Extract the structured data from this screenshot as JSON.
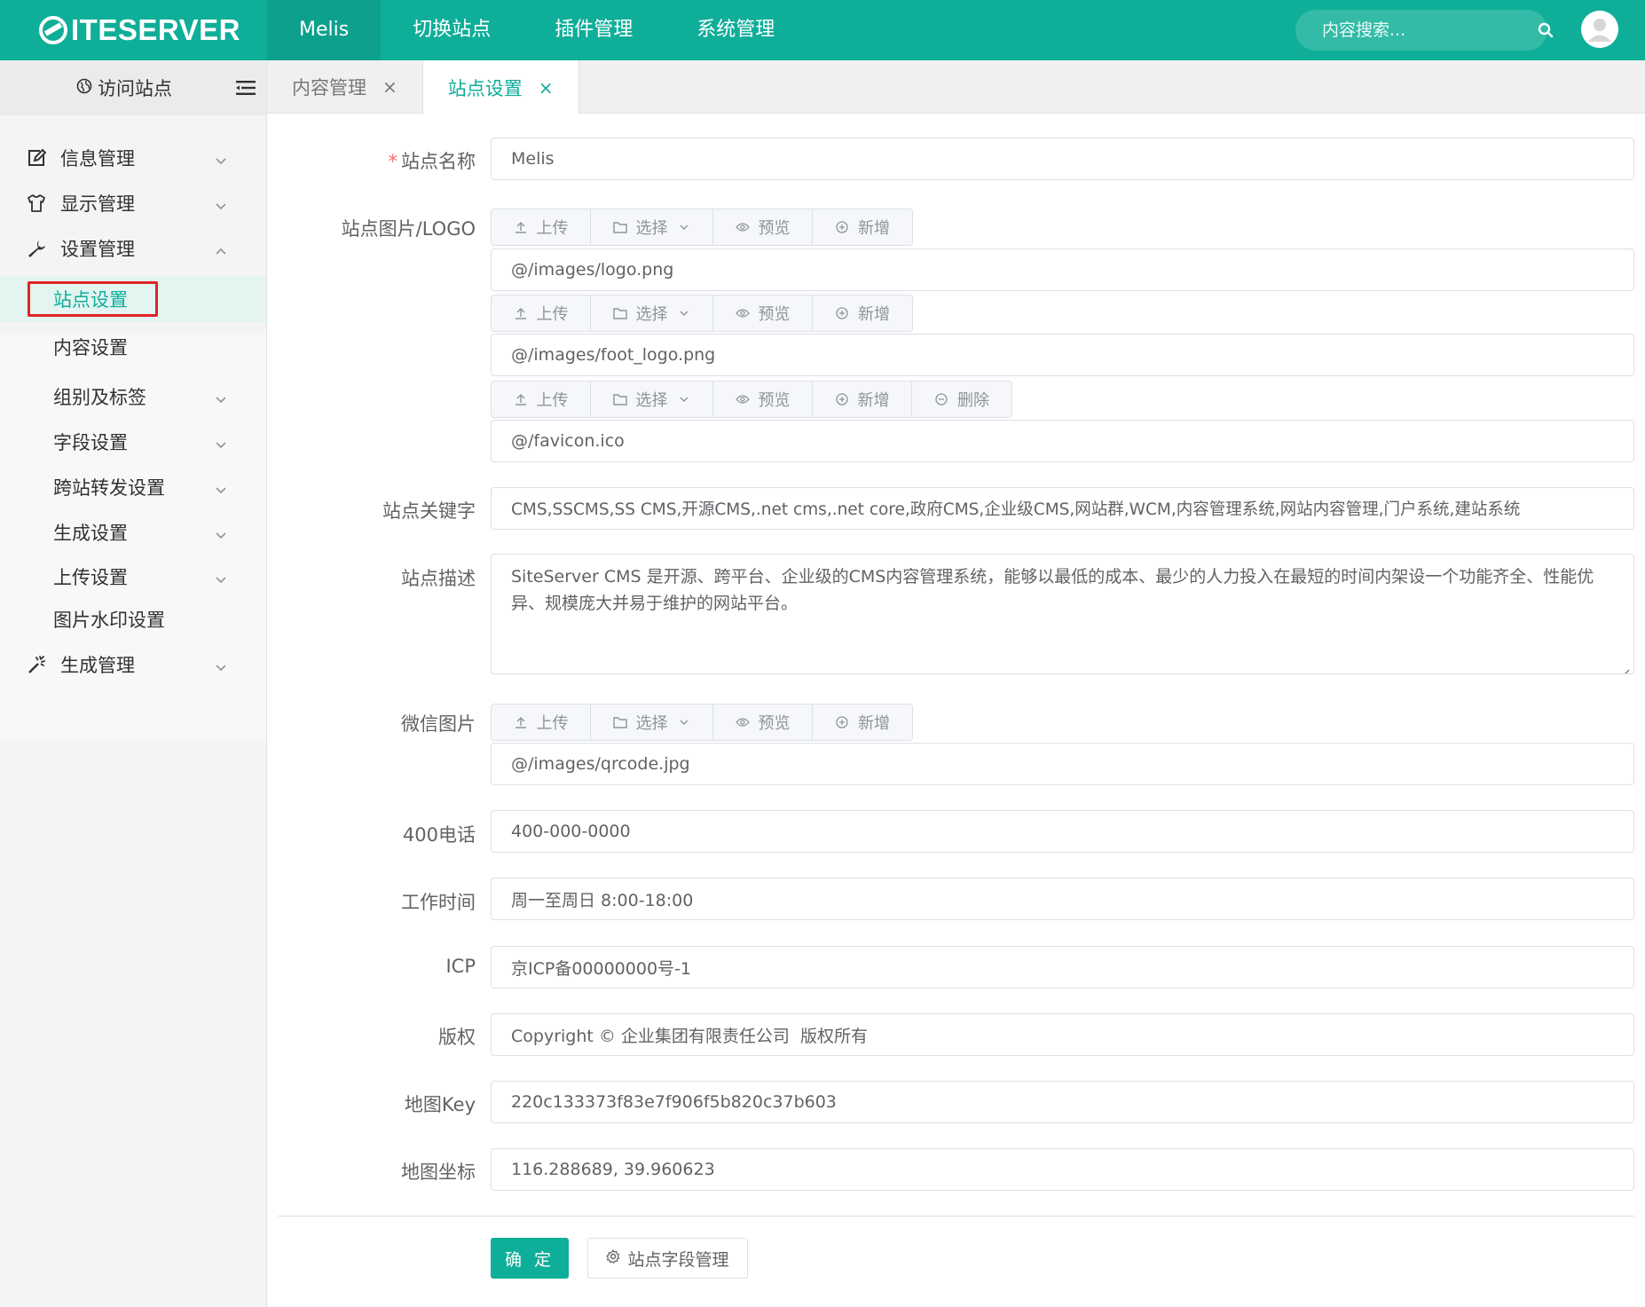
{
  "brand": {
    "logo_text": "ITESERVER",
    "logo_full": "SiteServer"
  },
  "topnav": {
    "items": [
      {
        "label": "Melis"
      },
      {
        "label": "切换站点"
      },
      {
        "label": "插件管理"
      },
      {
        "label": "系统管理"
      }
    ],
    "search_placeholder": "内容搜索..."
  },
  "sidebar": {
    "visit_label": "访问站点",
    "menus": [
      {
        "label": "信息管理"
      },
      {
        "label": "显示管理"
      },
      {
        "label": "设置管理"
      },
      {
        "label": "生成管理"
      }
    ],
    "submenu": [
      {
        "label": "站点设置"
      },
      {
        "label": "内容设置"
      },
      {
        "label": "组别及标签"
      },
      {
        "label": "字段设置"
      },
      {
        "label": "跨站转发设置"
      },
      {
        "label": "生成设置"
      },
      {
        "label": "上传设置"
      },
      {
        "label": "图片水印设置"
      }
    ]
  },
  "tabs": [
    {
      "label": "内容管理",
      "close": "×"
    },
    {
      "label": "站点设置",
      "close": "×"
    }
  ],
  "buttons": {
    "upload": "上传",
    "select": "选择",
    "preview": "预览",
    "add": "新增",
    "delete": "删除"
  },
  "form": {
    "site_name": {
      "label": "站点名称",
      "required_mark": "*",
      "value": "Melis"
    },
    "site_logo": {
      "label": "站点图片/LOGO",
      "values": [
        "@/images/logo.png",
        "@/images/foot_logo.png",
        "@/favicon.ico"
      ]
    },
    "keywords": {
      "label": "站点关键字",
      "value": "CMS,SSCMS,SS CMS,开源CMS,.net cms,.net core,政府CMS,企业级CMS,网站群,WCM,内容管理系统,网站内容管理,门户系统,建站系统"
    },
    "description": {
      "label": "站点描述",
      "value": "SiteServer CMS 是开源、跨平台、企业级的CMS内容管理系统，能够以最低的成本、最少的人力投入在最短的时间内架设一个功能齐全、性能优异、规模庞大并易于维护的网站平台。"
    },
    "wechat_image": {
      "label": "微信图片",
      "value": "@/images/qrcode.jpg"
    },
    "phone": {
      "label": "400电话",
      "value": "400-000-0000"
    },
    "work_time": {
      "label": "工作时间",
      "value": "周一至周日 8:00-18:00"
    },
    "icp": {
      "label": "ICP",
      "value": "京ICP备00000000号-1"
    },
    "copyright": {
      "label": "版权",
      "value": "Copyright © 企业集团有限责任公司  版权所有"
    },
    "map_key": {
      "label": "地图Key",
      "value": "220c133373f83e7f906f5b820c37b603"
    },
    "map_coords": {
      "label": "地图坐标",
      "value": "116.288689, 39.960623"
    }
  },
  "actions": {
    "confirm": "确 定",
    "field_manage": "站点字段管理"
  },
  "colors": {
    "accent": "#0fae99",
    "highlight_box": "#e02424",
    "required": "#f56c6c"
  },
  "icons": {
    "visit": "globe-icon",
    "menu_toggle": "hamburger-icon",
    "search": "search-icon",
    "info": "edit-icon",
    "display": "shirt-icon",
    "settings": "wrench-icon",
    "generate": "magic-wand-icon"
  }
}
